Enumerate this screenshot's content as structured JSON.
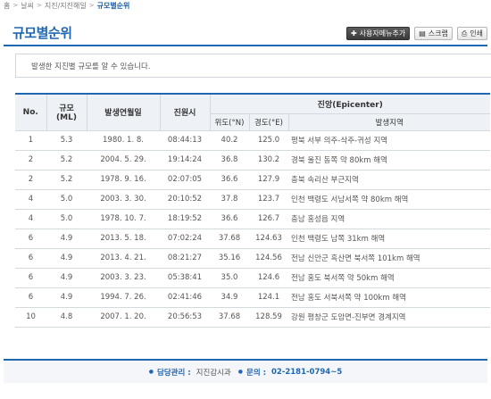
{
  "breadcrumb": {
    "items": [
      "홈",
      "날씨",
      "지진/지진해일"
    ],
    "current": "규모별순위"
  },
  "page_title": "규모별순위",
  "toolbar": {
    "add_menu": "사용자메뉴추가",
    "scrap": "스크랩",
    "print": "인쇄"
  },
  "info_text": "발생한 지진별 규모를 알 수 있습니다.",
  "table": {
    "headers": {
      "no": "No.",
      "scale": "규모",
      "scale_unit": "(ML)",
      "date": "발생연월일",
      "time": "진원시",
      "epicenter": "진앙(Epicenter)",
      "lat": "위도(°N)",
      "lon": "경도(°E)",
      "region": "발생지역"
    },
    "rows": [
      {
        "no": "1",
        "scale": "5.3",
        "date": "1980. 1. 8.",
        "time": "08:44:13",
        "lat": "40.2",
        "lon": "125.0",
        "region": "평북 서부 의주-삭주-귀성 지역"
      },
      {
        "no": "2",
        "scale": "5.2",
        "date": "2004. 5. 29.",
        "time": "19:14:24",
        "lat": "36.8",
        "lon": "130.2",
        "region": "경북 울진 동쪽 약 80km 해역"
      },
      {
        "no": "2",
        "scale": "5.2",
        "date": "1978. 9. 16.",
        "time": "02:07:05",
        "lat": "36.6",
        "lon": "127.9",
        "region": "충북 속리산 부근지역"
      },
      {
        "no": "4",
        "scale": "5.0",
        "date": "2003. 3. 30.",
        "time": "20:10:52",
        "lat": "37.8",
        "lon": "123.7",
        "region": "인천 백령도 서남서쪽 약 80km 해역"
      },
      {
        "no": "4",
        "scale": "5.0",
        "date": "1978. 10. 7.",
        "time": "18:19:52",
        "lat": "36.6",
        "lon": "126.7",
        "region": "충남 홍성읍 지역"
      },
      {
        "no": "6",
        "scale": "4.9",
        "date": "2013. 5. 18.",
        "time": "07:02:24",
        "lat": "37.68",
        "lon": "124.63",
        "region": "인천 백령도 남쪽 31km 해역"
      },
      {
        "no": "6",
        "scale": "4.9",
        "date": "2013. 4. 21.",
        "time": "08:21:27",
        "lat": "35.16",
        "lon": "124.56",
        "region": "전남 신안군 흑산면 북서쪽 101km 해역"
      },
      {
        "no": "6",
        "scale": "4.9",
        "date": "2003. 3. 23.",
        "time": "05:38:41",
        "lat": "35.0",
        "lon": "124.6",
        "region": "전남 홍도 북서쪽 약 50km 해역"
      },
      {
        "no": "6",
        "scale": "4.9",
        "date": "1994. 7. 26.",
        "time": "02:41:46",
        "lat": "34.9",
        "lon": "124.1",
        "region": "전남 홍도 서북서쪽 약 100km 해역"
      },
      {
        "no": "10",
        "scale": "4.8",
        "date": "2007. 1. 20.",
        "time": "20:56:53",
        "lat": "37.68",
        "lon": "128.59",
        "region": "강원 평창군 도암면-진부면 경계지역"
      }
    ]
  },
  "footer": {
    "manager_label": "담당관리 :",
    "manager_value": "지진감시과",
    "contact_label": "문의 :",
    "contact_value": "02-2181-0794~5"
  },
  "colors": {
    "accent": "#1f67b1",
    "header_bg": "#eef2f7"
  }
}
